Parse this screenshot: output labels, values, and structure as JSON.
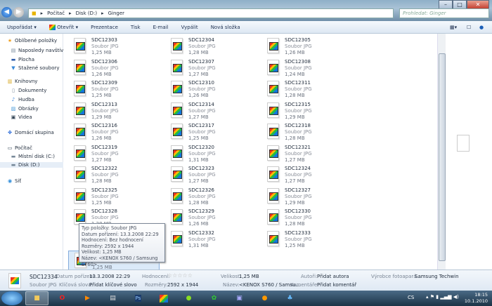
{
  "address": {
    "crumbs": [
      "Počítač",
      "Disk (D:)",
      "Ginger"
    ],
    "search_placeholder": "Prohledat: Ginger"
  },
  "toolbar": {
    "organize": "Uspořádat ▾",
    "open": "Otevřít ▾",
    "slideshow": "Prezentace",
    "print": "Tisk",
    "email": "E-mail",
    "burn": "Vypálit",
    "new_folder": "Nová složka"
  },
  "sidebar": {
    "items": [
      {
        "label": "Oblíbené položky",
        "icon": "star-icon"
      },
      {
        "label": "Naposledy navštívené",
        "icon": "recent-icon"
      },
      {
        "label": "Plocha",
        "icon": "desktop-icon"
      },
      {
        "label": "Stažené soubory",
        "icon": "downloads-icon"
      },
      {
        "label": "Knihovny",
        "icon": "libraries-icon"
      },
      {
        "label": "Dokumenty",
        "icon": "documents-icon"
      },
      {
        "label": "Hudba",
        "icon": "music-icon"
      },
      {
        "label": "Obrázky",
        "icon": "pictures-icon"
      },
      {
        "label": "Videa",
        "icon": "videos-icon"
      },
      {
        "label": "Domácí skupina",
        "icon": "homegroup-icon"
      },
      {
        "label": "Počítač",
        "icon": "computer-icon"
      },
      {
        "label": "Místní disk (C:)",
        "icon": "drive-icon"
      },
      {
        "label": "Disk (D:)",
        "icon": "drive-icon"
      },
      {
        "label": "Síť",
        "icon": "network-icon"
      }
    ]
  },
  "file_type": "Soubor JPG",
  "files": [
    {
      "name": "SDC12303",
      "size": "1,25 MB"
    },
    {
      "name": "SDC12304",
      "size": "1,28 MB"
    },
    {
      "name": "SDC12305",
      "size": "1,26 MB"
    },
    {
      "name": "SDC12306",
      "size": "1,26 MB"
    },
    {
      "name": "SDC12307",
      "size": "1,27 MB"
    },
    {
      "name": "SDC12308",
      "size": "1,24 MB"
    },
    {
      "name": "SDC12309",
      "size": "1,25 MB"
    },
    {
      "name": "SDC12310",
      "size": "1,26 MB"
    },
    {
      "name": "SDC12311",
      "size": "1,28 MB"
    },
    {
      "name": "SDC12313",
      "size": "1,29 MB"
    },
    {
      "name": "SDC12314",
      "size": "1,27 MB"
    },
    {
      "name": "SDC12315",
      "size": "1,29 MB"
    },
    {
      "name": "SDC12316",
      "size": "1,26 MB"
    },
    {
      "name": "SDC12317",
      "size": "1,25 MB"
    },
    {
      "name": "SDC12318",
      "size": "1,28 MB"
    },
    {
      "name": "SDC12319",
      "size": "1,27 MB"
    },
    {
      "name": "SDC12320",
      "size": "1,31 MB"
    },
    {
      "name": "SDC12321",
      "size": "1,27 MB"
    },
    {
      "name": "SDC12322",
      "size": "1,28 MB"
    },
    {
      "name": "SDC12323",
      "size": "1,27 MB"
    },
    {
      "name": "SDC12324",
      "size": "1,27 MB"
    },
    {
      "name": "SDC12325",
      "size": "1,25 MB"
    },
    {
      "name": "SDC12326",
      "size": "1,28 MB"
    },
    {
      "name": "SDC12327",
      "size": "1,29 MB"
    },
    {
      "name": "SDC12328",
      "size": "1,28 MB"
    },
    {
      "name": "SDC12329",
      "size": "1,26 MB"
    },
    {
      "name": "SDC12330",
      "size": "1,28 MB"
    },
    {
      "name": "",
      "size": ""
    },
    {
      "name": "SDC12332",
      "size": "1,31 MB"
    },
    {
      "name": "SDC12333",
      "size": "1,25 MB"
    },
    {
      "name": "SDC12334",
      "size": "1,25 MB",
      "selected": true
    }
  ],
  "tooltip": [
    "Typ položky: Soubor JPG",
    "Datum pořízení: 13.3.2008 22:29",
    "Hodnocení: Bez hodnocení",
    "Rozměry: 2592 x 1944",
    "Velikost: 1,25 MB",
    "Název: <KENOX S760  / Samsung S760>"
  ],
  "details": {
    "name": "SDC12334",
    "type": "Soubor JPG",
    "date_label": "Datum pořízení:",
    "date": "13.3.2008 22:29",
    "keywords_label": "Klíčová slova:",
    "keywords": "Přidat klíčové slovo",
    "rating_label": "Hodnocení:",
    "rating": 0,
    "dims_label": "Rozměry:",
    "dims": "2592 x 1944",
    "size_label": "Velikost:",
    "size": "1,25 MB",
    "title_label": "Název:",
    "title": "<KENOX S760  / Samsu...",
    "author_label": "Autoři:",
    "author": "Přidat autora",
    "comments_label": "Komentáře:",
    "comments": "Přidat komentář",
    "maker_label": "Výrobce fotoapará...",
    "maker": "Samsung Techwin"
  },
  "taskbar": {
    "lang": "CS",
    "time": "18:15",
    "date": "10.1.2010"
  }
}
